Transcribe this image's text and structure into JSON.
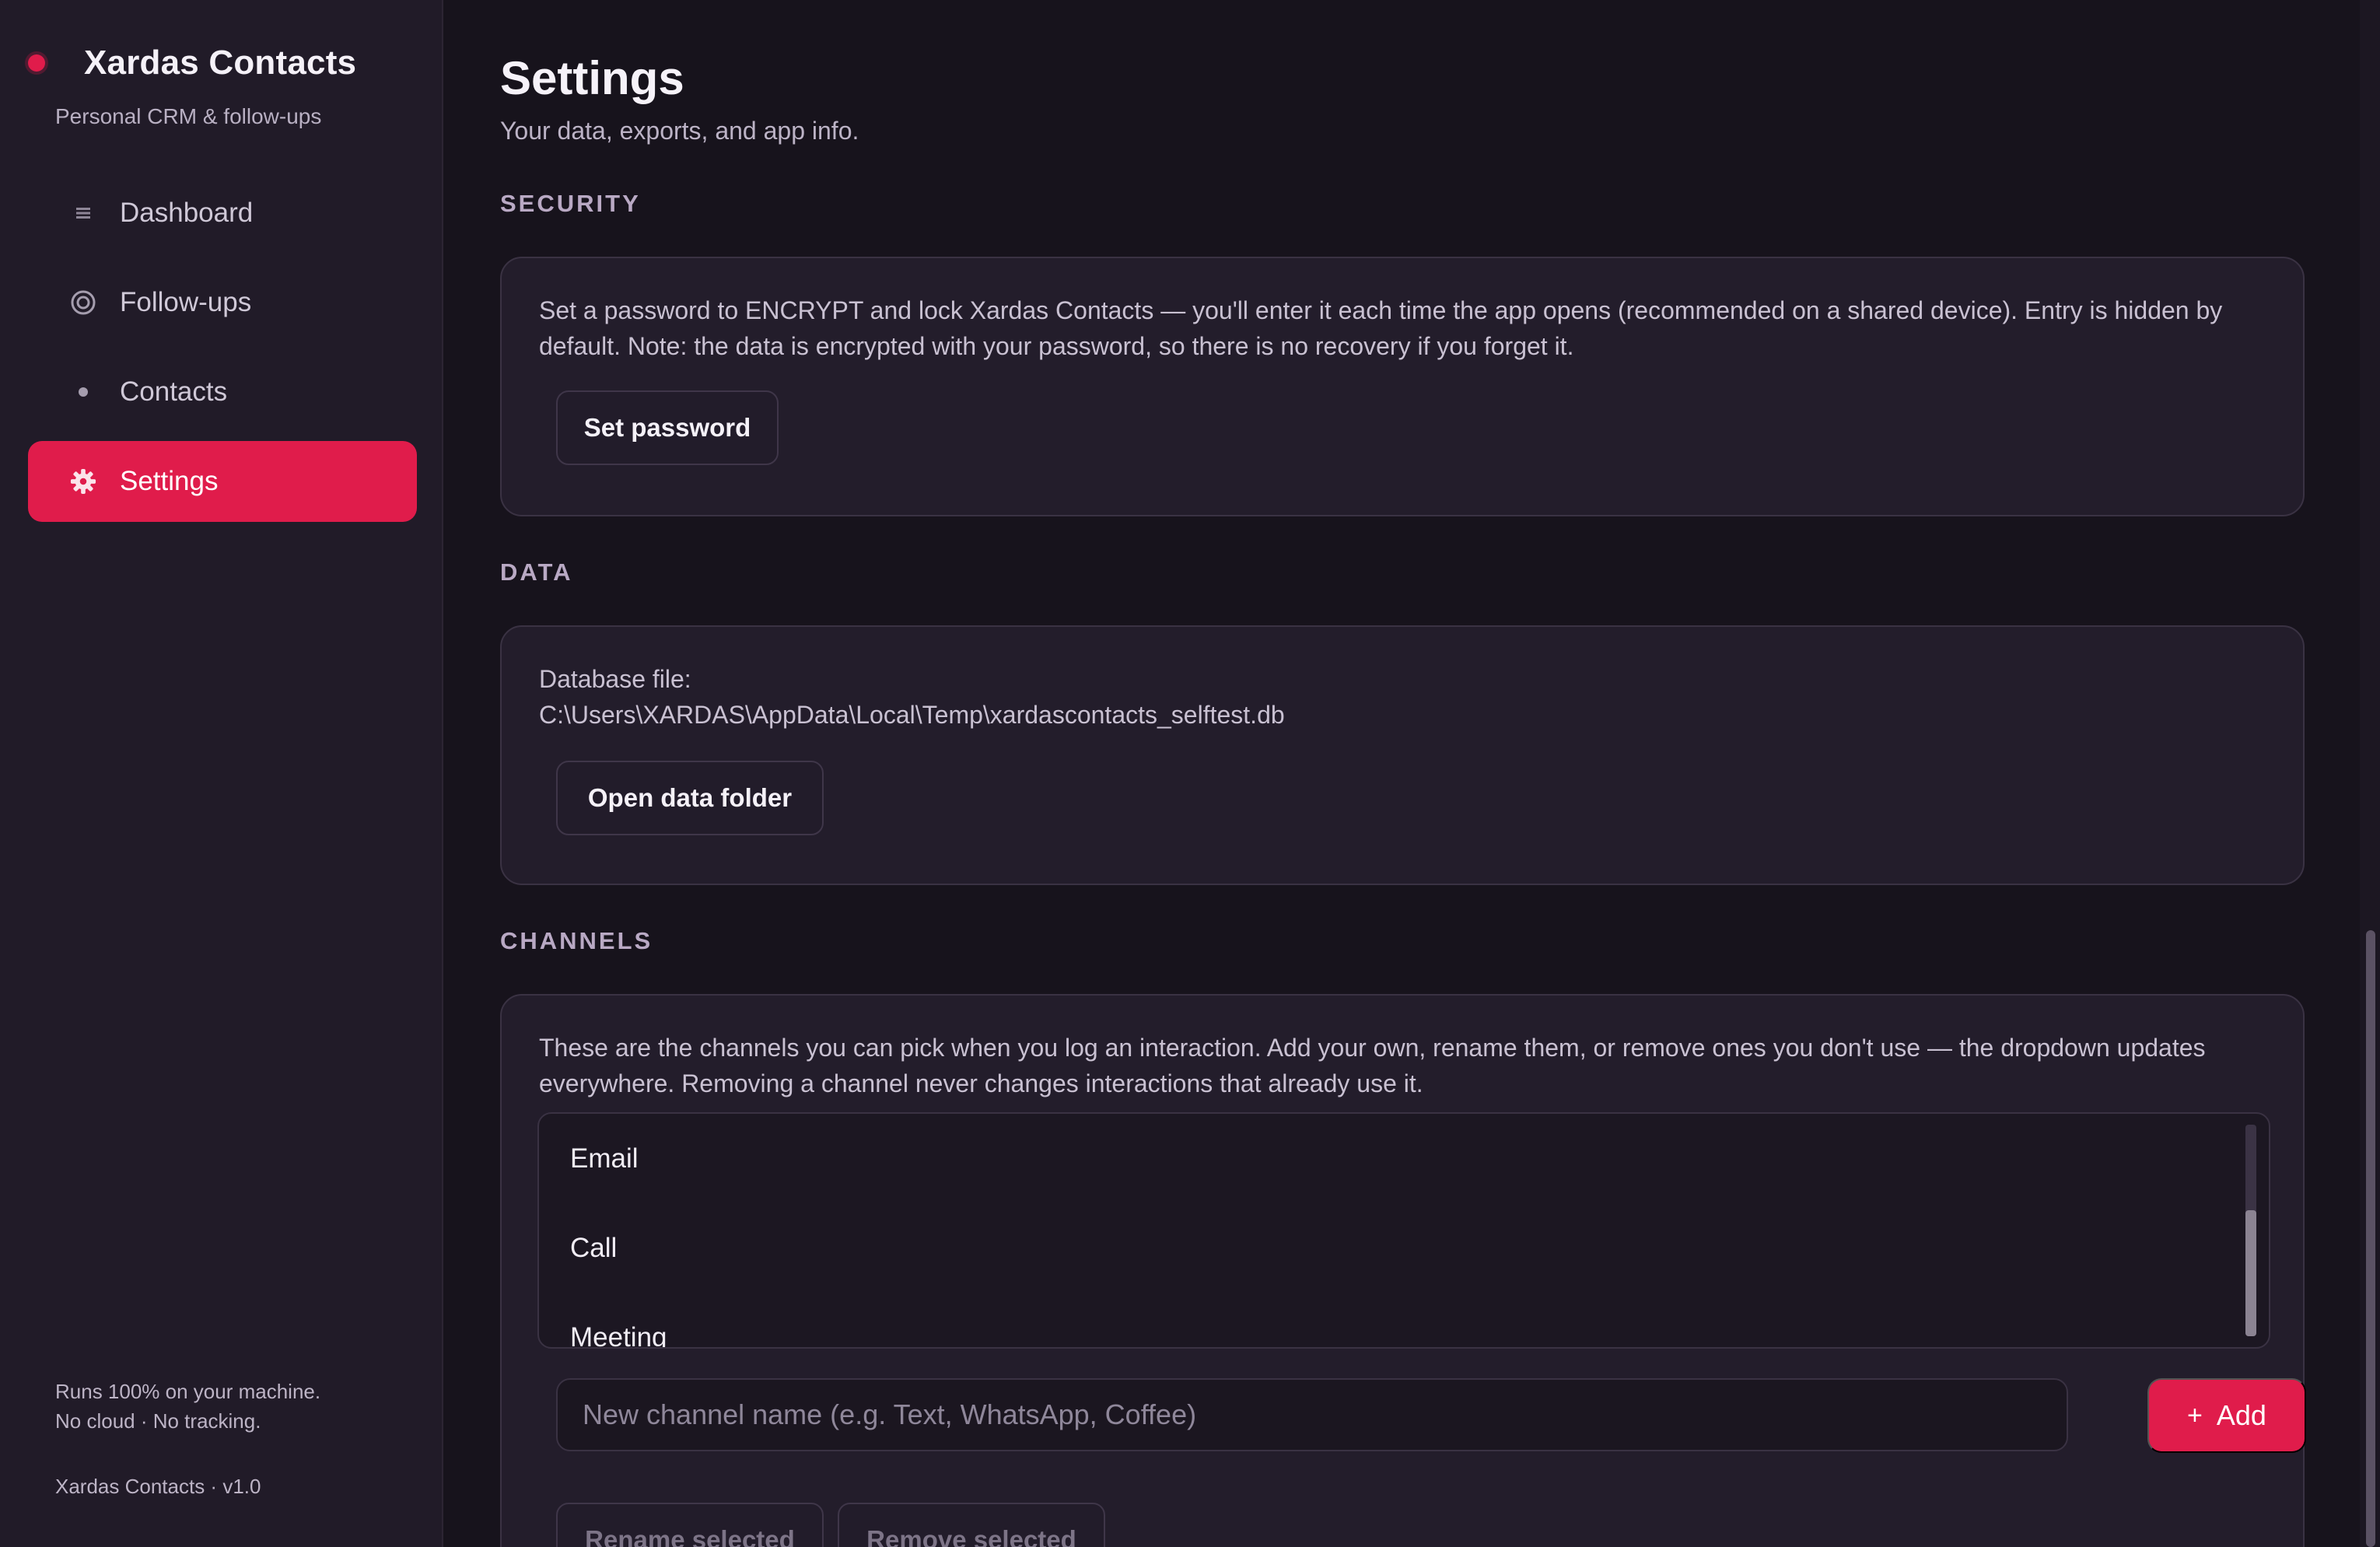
{
  "app": {
    "title": "Xardas Contacts",
    "subtitle": "Personal CRM & follow-ups",
    "accent": "#e01c4b"
  },
  "nav": {
    "items": [
      {
        "label": "Dashboard",
        "icon": "grid-icon"
      },
      {
        "label": "Follow-ups",
        "icon": "target-icon"
      },
      {
        "label": "Contacts",
        "icon": "dot-icon"
      },
      {
        "label": "Settings",
        "icon": "gear-icon",
        "active": true
      }
    ]
  },
  "footer": {
    "line1": "Runs 100% on your machine.",
    "line2": "No cloud · No tracking.",
    "version": "Xardas Contacts · v1.0"
  },
  "page": {
    "title": "Settings",
    "subtitle": "Your data, exports, and app info."
  },
  "security": {
    "heading": "SECURITY",
    "description": "Set a password to ENCRYPT and lock Xardas Contacts — you'll enter it each time the app opens (recommended on a shared device). Entry is hidden by default. Note: the data is encrypted with your password, so there is no recovery if you forget it.",
    "button_label": "Set password"
  },
  "data": {
    "heading": "DATA",
    "label": "Database file:",
    "path": "C:\\Users\\XARDAS\\AppData\\Local\\Temp\\xardascontacts_selftest.db",
    "button_label": "Open data folder"
  },
  "channels": {
    "heading": "CHANNELS",
    "description": "These are the channels you can pick when you log an interaction. Add your own, rename them, or remove ones you don't use — the dropdown updates everywhere. Removing a channel never changes interactions that already use it.",
    "items": [
      "Email",
      "Call",
      "Meeting"
    ],
    "input_placeholder": "New channel name (e.g. Text, WhatsApp, Coffee)",
    "add_label": "Add",
    "rename_label": "Rename selected",
    "remove_label": "Remove selected"
  }
}
